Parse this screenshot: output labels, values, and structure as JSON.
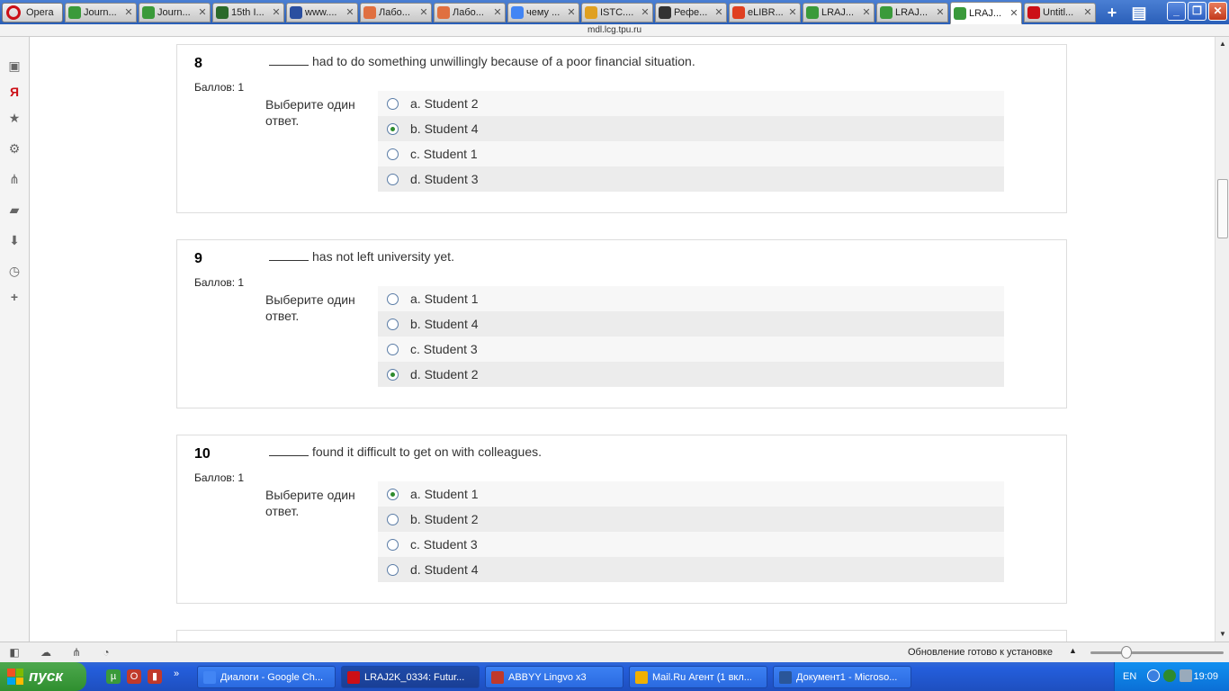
{
  "browser": {
    "opera_label": "Opera",
    "tabs": [
      {
        "label": "Journ...",
        "color": "#3a9a3a"
      },
      {
        "label": "Journ...",
        "color": "#3a9a3a"
      },
      {
        "label": "15th I...",
        "color": "#2b6a2b"
      },
      {
        "label": "www....",
        "color": "#2a4fa0"
      },
      {
        "label": "Лабо...",
        "color": "#e07040"
      },
      {
        "label": "Лабо...",
        "color": "#e07040"
      },
      {
        "label": "чему ...",
        "color": "#4285f4"
      },
      {
        "label": "ISTC....",
        "color": "#e0a020"
      },
      {
        "label": "Рефе...",
        "color": "#333333"
      },
      {
        "label": "eLIBR...",
        "color": "#e04020"
      },
      {
        "label": "LRAJ...",
        "color": "#3a9a3a"
      },
      {
        "label": "LRAJ...",
        "color": "#3a9a3a"
      },
      {
        "label": "LRAJ...",
        "color": "#3a9a3a"
      },
      {
        "label": "Untitl...",
        "color": "#cc0f16"
      }
    ],
    "active_tab_index": 12,
    "close_glyph": "✕",
    "address": "mdl.lcg.tpu.ru",
    "window_buttons": {
      "minimize": "_",
      "restore": "❐",
      "close": "✕"
    }
  },
  "questions": [
    {
      "number": "8",
      "points": "Баллов: 1",
      "text": "had to do something unwillingly because of a poor financial situation.",
      "prompt": "Выберите один ответ.",
      "answers": [
        "a. Student 2",
        "b. Student 4",
        "c. Student 1",
        "d. Student 3"
      ],
      "selected": 1
    },
    {
      "number": "9",
      "points": "Баллов: 1",
      "text": "has not left university yet.",
      "prompt": "Выберите один ответ.",
      "answers": [
        "a. Student 1",
        "b. Student 4",
        "c. Student 3",
        "d. Student 2"
      ],
      "selected": 3
    },
    {
      "number": "10",
      "points": "Баллов: 1",
      "text": "found it difficult to get on with colleagues.",
      "prompt": "Выберите один ответ.",
      "answers": [
        "a. Student 1",
        "b. Student 2",
        "c. Student 3",
        "d. Student 4"
      ],
      "selected": 0
    }
  ],
  "statusbar": {
    "update_text": "Обновление готово к установке"
  },
  "taskbar": {
    "start_label": "пуск",
    "tasks": [
      {
        "label": "Диалоги - Google Ch...",
        "color": "#4285f4"
      },
      {
        "label": "LRAJ2K_0334: Futur...",
        "color": "#cc0f16"
      },
      {
        "label": "ABBYY Lingvo x3",
        "color": "#c0392b"
      },
      {
        "label": "Mail.Ru Агент (1 вкл...",
        "color": "#f0b000"
      },
      {
        "label": "Документ1 - Microso...",
        "color": "#2a5699"
      }
    ],
    "active_task_index": 1,
    "tray": {
      "language": "EN",
      "clock": "19:09"
    }
  }
}
